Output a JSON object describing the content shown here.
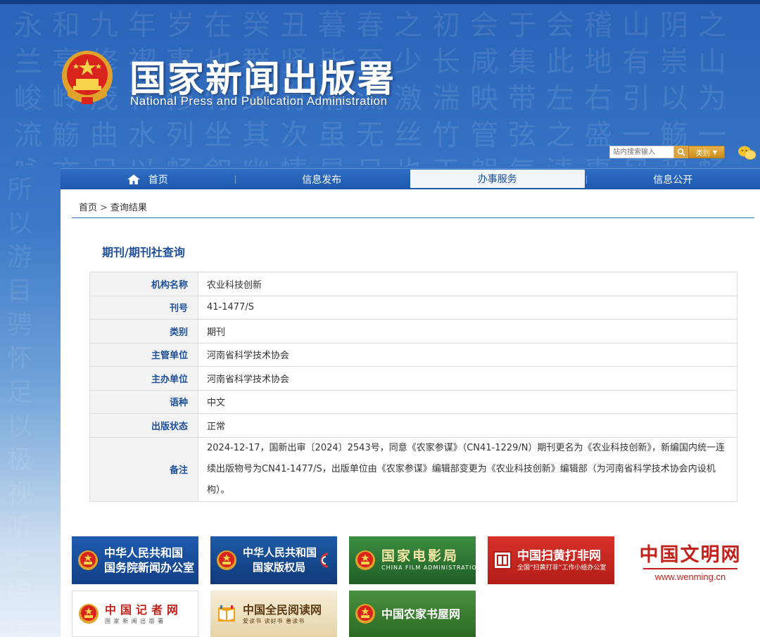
{
  "header": {
    "title_cn": "国家新闻出版署",
    "title_en": "National Press and Publication Administration"
  },
  "search": {
    "placeholder": "站内搜索输入",
    "scope_label": "类别"
  },
  "nav": {
    "items": [
      {
        "label": "首页"
      },
      {
        "label": "信息发布"
      },
      {
        "label": "办事服务"
      },
      {
        "label": "信息公开"
      }
    ],
    "active_index": 2
  },
  "breadcrumb": {
    "home": "首页",
    "separator": ">",
    "current": "查询结果"
  },
  "section_title": "期刊/期刊社查询",
  "record": {
    "rows": [
      {
        "label": "机构名称",
        "value": "农业科技创新"
      },
      {
        "label": "刊号",
        "value": "41-1477/S"
      },
      {
        "label": "类别",
        "value": "期刊"
      },
      {
        "label": "主管单位",
        "value": "河南省科学技术协会"
      },
      {
        "label": "主办单位",
        "value": "河南省科学技术协会"
      },
      {
        "label": "语种",
        "value": "中文"
      },
      {
        "label": "出版状态",
        "value": "正常"
      },
      {
        "label": "备注",
        "value": "2024-12-17，国新出审〔2024〕2543号，同意《农家参谋》（CN41-1229/N）期刊更名为《农业科技创新》，新编国内统一连续出版物号为CN41-1477/S，出版单位由《农家参谋》编辑部变更为《农业科技创新》编辑部（为河南省科学技术协会内设机构）。"
      }
    ]
  },
  "links": {
    "scio": {
      "line1": "中华人民共和国",
      "line2": "国务院新闻办公室"
    },
    "ncac": {
      "line1": "中华人民共和国",
      "line2": "国家版权局"
    },
    "film": {
      "main": "国家电影局",
      "sub": "CHINA FILM ADMINISTRATION"
    },
    "saohuang": {
      "main": "中国扫黄打非网",
      "sub": "全国“扫黄打非”工作小组办公室"
    },
    "wenming": {
      "main": "中国文明网",
      "url": "www.wenming.cn"
    },
    "jizhe": {
      "main": "中国记者网",
      "sub": "国 家 新 闻 出 版 署"
    },
    "yuedu": {
      "main": "中国全民阅读网",
      "sub": "爱读书  读好书  善读书"
    },
    "nongjia": {
      "main": "中国农家书屋网"
    }
  },
  "colors": {
    "nav_blue": "#1d58ad",
    "title_blue": "#1d4f9a",
    "accent_gold": "#d9a441",
    "wenming_red": "#c1221c"
  }
}
